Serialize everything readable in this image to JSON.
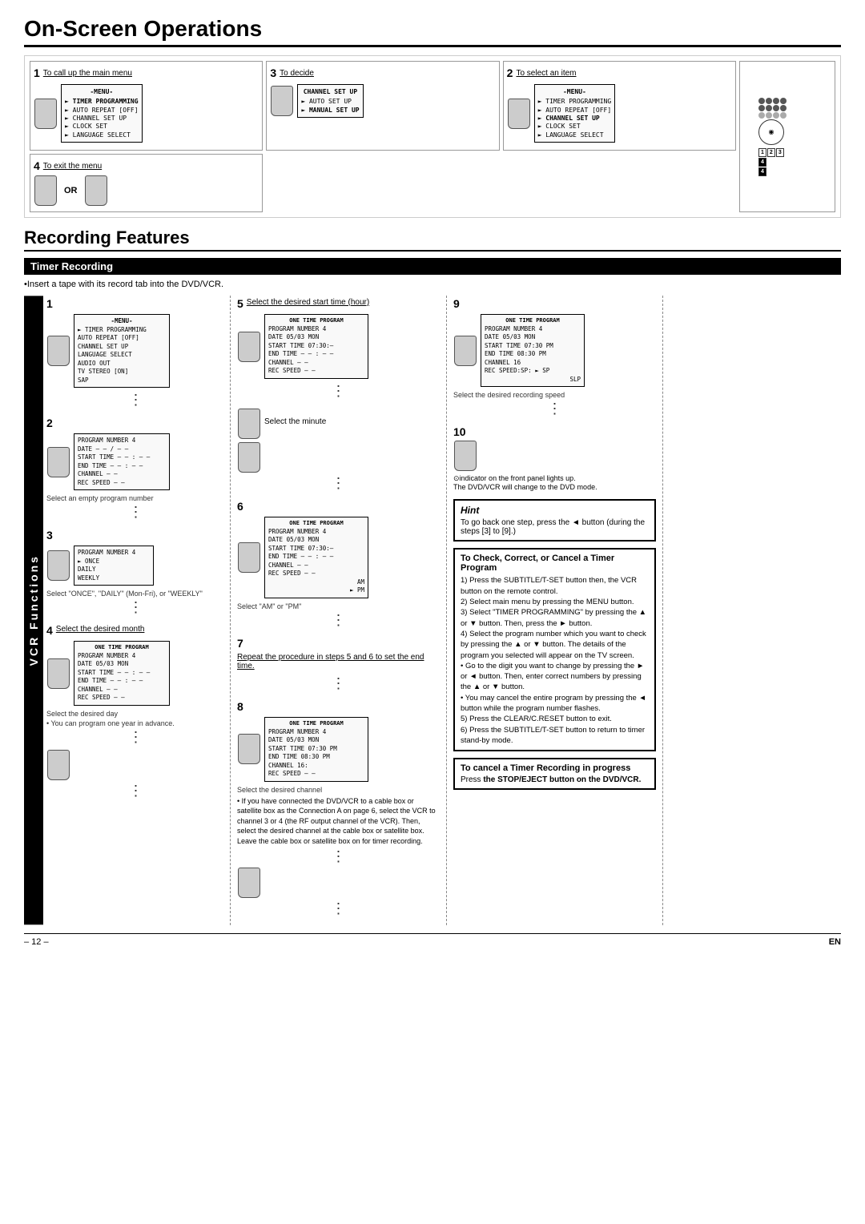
{
  "page": {
    "title": "On-Screen Operations",
    "section2_title": "Recording Features",
    "timer_recording_header": "Timer Recording",
    "insert_tape_note": "•Insert a tape with its record tab into the DVD/VCR.",
    "page_number": "– 12 –",
    "en_label": "EN"
  },
  "onscreen_steps": [
    {
      "num": "1",
      "desc": "To call up the main menu",
      "screen_title": "-MENU-",
      "screen_items": [
        "TIMER PROGRAMMING",
        "AUTO REPEAT  [OFF]",
        "CHANNEL SET UP",
        "CLOCK SET",
        "LANGUAGE SELECT"
      ]
    },
    {
      "num": "3",
      "desc": "To decide",
      "screen_title": "CHANNEL SET UP",
      "screen_items": [
        "AUTO SET UP",
        "MANUAL SET UP"
      ]
    },
    {
      "num": "2",
      "desc": "To select an item",
      "screen_title": "-MENU-",
      "screen_items": [
        "TIMER PROGRAMMING",
        "AUTO REPEAT  [OFF]",
        "CHANNEL SET UP",
        "CLOCK SET",
        "LANGUAGE SELECT"
      ]
    },
    {
      "num": "4",
      "desc": "To exit the menu",
      "or_text": "OR"
    }
  ],
  "vcr_steps_left": [
    {
      "num": "1",
      "screen_title": "-MENU-",
      "screen_items": [
        "TIMER PROGRAMMING",
        "AUTO REPEAT  [OFF]",
        "CHANNEL SET UP",
        "LANGUAGE SELECT",
        "AUDIO OUT",
        "TV STEREO  [ON]",
        "SAP"
      ]
    },
    {
      "num": "2",
      "screen_title": "",
      "screen_fields": [
        "PROGRAM NUMBER  4",
        "DATE      – – / – –",
        "START TIME  – – : – –",
        "END TIME   – – : – –",
        "CHANNEL    – –",
        "REC SPEED  – –"
      ],
      "sub_desc": "Select an empty program number"
    },
    {
      "num": "3",
      "screen_fields": [
        "PROGRAM NUMBER 4",
        "► ONCE",
        "  DAILY",
        "  WEEKLY"
      ],
      "sub_desc": "Select \"ONCE\", \"DAILY\" (Mon-Fri), or \"WEEKLY\""
    },
    {
      "num": "4",
      "desc": "Select the desired month",
      "screen_title": "ONE TIME PROGRAM",
      "screen_fields": [
        "PROGRAM NUMBER  4",
        "DATE     05/03 MON",
        "START TIME  – – : – –",
        "END TIME   – – : – –",
        "CHANNEL   – –",
        "REC SPEED  – –"
      ],
      "sub_desc1": "Select the desired day",
      "sub_desc2": "• You can program one year in advance."
    }
  ],
  "vcr_steps_middle": [
    {
      "num": "5",
      "desc": "Select the desired start time (hour)",
      "screen_title": "ONE TIME PROGRAM",
      "screen_fields": [
        "PROGRAM NUMBER  4",
        "DATE     05/03 MON",
        "START TIME  07:30:–",
        "END TIME   – – : – –",
        "CHANNEL   – –",
        "REC SPEED  – –"
      ]
    },
    {
      "num": "",
      "desc": "Select the minute"
    },
    {
      "num": "6",
      "screen_title": "ONE TIME PROGRAM",
      "screen_fields": [
        "PROGRAM NUMBER  4",
        "DATE     05/03 MON",
        "START TIME  07:30:–",
        "END TIME   – – : – –",
        "CHANNEL   – –",
        "REC SPEED  – –",
        "                  AM",
        "             ► PM"
      ],
      "sub_desc": "Select \"AM\" or \"PM\""
    },
    {
      "num": "7",
      "desc": "Repeat the procedure in steps 5 and 6 to set the end time."
    },
    {
      "num": "8",
      "screen_title": "ONE TIME PROGRAM",
      "screen_fields": [
        "PROGRAM NUMBER  4",
        "DATE     05/03 MON",
        "START TIME  07:30 PM",
        "END TIME   08:30 PM",
        "CHANNEL   16:",
        "REC SPEED  – –"
      ],
      "sub_desc": "Select the desired channel",
      "footnote": "• If you have connected the DVD/VCR to a cable box or satellite box as the Connection A on page 6, select the VCR to channel 3 or 4 (the RF output channel of the VCR). Then, select the desired channel at the cable box or satellite box. Leave the cable box or satellite box on for timer recording."
    }
  ],
  "vcr_steps_right": [
    {
      "num": "9",
      "screen_title": "ONE TIME PROGRAM",
      "screen_fields": [
        "PROGRAM NUMBER  4",
        "DATE     05/03 MON",
        "START TIME  07:30 PM",
        "END TIME   08:30 PM",
        "CHANNEL    16",
        "REC SPEED:SP: ►  SP",
        "                SLP"
      ],
      "sub_desc": "Select the desired recording speed"
    },
    {
      "num": "10",
      "bullet1": "⊙indicator on the front panel lights up.",
      "bullet2": "The DVD/VCR will change to the DVD mode."
    }
  ],
  "hint": {
    "title": "Hint",
    "text": "To go back one step, press the ◄ button (during the steps [3] to [9].)"
  },
  "check_correct_cancel": {
    "title": "To Check, Correct, or Cancel a Timer Program",
    "steps": [
      "1) Press the SUBTITLE/T-SET button then, the VCR button on the remote control.",
      "2) Select main menu by pressing the MENU button.",
      "3) Select \"TIMER PROGRAMMING\" by pressing the ▲ or ▼ button. Then, press the ► button.",
      "4) Select the program number which you want to check by pressing the ▲ or ▼ button. The details of the program you selected will appear on the TV screen.",
      "• Go to the digit you want to change by pressing the ► or ◄ button. Then, enter correct numbers by pressing the ▲ or ▼ button.",
      "• You may cancel the entire program by pressing the ◄ button while the program number flashes.",
      "5) Press the CLEAR/C.RESET button to exit.",
      "6) Press the SUBTITLE/T-SET button to return to timer stand-by mode."
    ]
  },
  "cancel_timer": {
    "title": "To cancel a Timer Recording in progress",
    "text": "Press the STOP/EJECT button on the DVD/VCR."
  }
}
